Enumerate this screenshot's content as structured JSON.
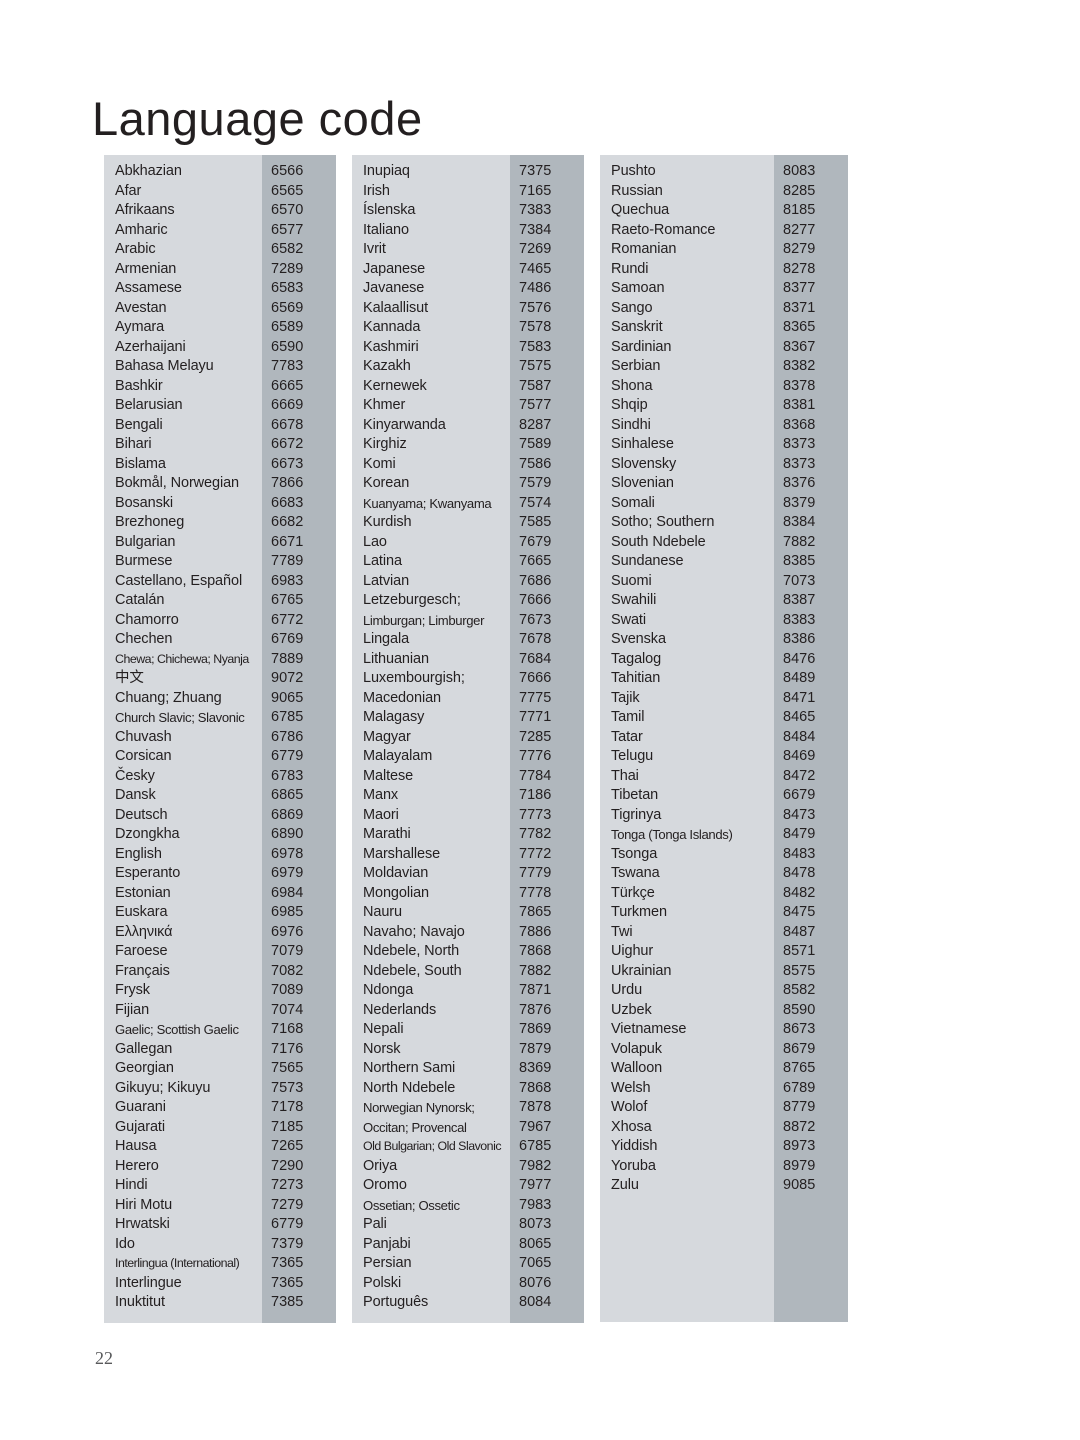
{
  "page": {
    "title": "Language code",
    "page_number": "22",
    "colors": {
      "name_cell_background": "#d6d9dd",
      "code_cell_background": "#b0b7bd",
      "text": "#231f20",
      "page_background": "#ffffff"
    }
  },
  "columns": [
    {
      "id": "column-1",
      "rows": [
        {
          "language": "Abkhazian",
          "code": "6566"
        },
        {
          "language": "Afar",
          "code": "6565"
        },
        {
          "language": "Afrikaans",
          "code": "6570"
        },
        {
          "language": "Amharic",
          "code": "6577"
        },
        {
          "language": "Arabic",
          "code": "6582"
        },
        {
          "language": "Armenian",
          "code": "7289"
        },
        {
          "language": "Assamese",
          "code": "6583"
        },
        {
          "language": "Avestan",
          "code": "6569"
        },
        {
          "language": "Aymara",
          "code": "6589"
        },
        {
          "language": "Azerhaijani",
          "code": "6590"
        },
        {
          "language": "Bahasa Melayu",
          "code": "7783"
        },
        {
          "language": "Bashkir",
          "code": "6665"
        },
        {
          "language": "Belarusian",
          "code": "6669"
        },
        {
          "language": "Bengali",
          "code": "6678"
        },
        {
          "language": "Bihari",
          "code": "6672"
        },
        {
          "language": "Bislama",
          "code": "6673"
        },
        {
          "language": "Bokmål, Norwegian",
          "code": "7866"
        },
        {
          "language": "Bosanski",
          "code": "6683"
        },
        {
          "language": "Brezhoneg",
          "code": "6682"
        },
        {
          "language": "Bulgarian",
          "code": "6671"
        },
        {
          "language": "Burmese",
          "code": "7789"
        },
        {
          "language": "Castellano, Español",
          "code": "6983"
        },
        {
          "language": "Catalán",
          "code": "6765"
        },
        {
          "language": "Chamorro",
          "code": "6772"
        },
        {
          "language": "Chechen",
          "code": "6769"
        },
        {
          "language": "Chewa; Chichewa; Nyanja",
          "code": "7889",
          "size": "tighter"
        },
        {
          "language": "中文",
          "code": "9072"
        },
        {
          "language": "Chuang; Zhuang",
          "code": "9065"
        },
        {
          "language": "Church Slavic; Slavonic",
          "code": "6785",
          "size": "tight"
        },
        {
          "language": "Chuvash",
          "code": "6786"
        },
        {
          "language": "Corsican",
          "code": "6779"
        },
        {
          "language": "Česky",
          "code": "6783"
        },
        {
          "language": "Dansk",
          "code": "6865"
        },
        {
          "language": "Deutsch",
          "code": "6869"
        },
        {
          "language": "Dzongkha",
          "code": "6890"
        },
        {
          "language": "English",
          "code": "6978"
        },
        {
          "language": "Esperanto",
          "code": "6979"
        },
        {
          "language": "Estonian",
          "code": "6984"
        },
        {
          "language": "Euskara",
          "code": "6985"
        },
        {
          "language": "Ελληνικά",
          "code": "6976"
        },
        {
          "language": "Faroese",
          "code": "7079"
        },
        {
          "language": "Français",
          "code": "7082"
        },
        {
          "language": "Frysk",
          "code": "7089"
        },
        {
          "language": "Fijian",
          "code": "7074"
        },
        {
          "language": "Gaelic; Scottish Gaelic",
          "code": "7168",
          "size": "tight"
        },
        {
          "language": "Gallegan",
          "code": "7176"
        },
        {
          "language": "Georgian",
          "code": "7565"
        },
        {
          "language": "Gikuyu; Kikuyu",
          "code": "7573"
        },
        {
          "language": "Guarani",
          "code": "7178"
        },
        {
          "language": "Gujarati",
          "code": "7185"
        },
        {
          "language": "Hausa",
          "code": "7265"
        },
        {
          "language": "Herero",
          "code": "7290"
        },
        {
          "language": "Hindi",
          "code": "7273"
        },
        {
          "language": "Hiri Motu",
          "code": "7279"
        },
        {
          "language": "Hrwatski",
          "code": "6779"
        },
        {
          "language": "Ido",
          "code": "7379"
        },
        {
          "language": "Interlingua (International)",
          "code": "7365",
          "size": "tighter"
        },
        {
          "language": "Interlingue",
          "code": "7365"
        },
        {
          "language": "Inuktitut",
          "code": "7385"
        }
      ]
    },
    {
      "id": "column-2",
      "rows": [
        {
          "language": "Inupiaq",
          "code": "7375"
        },
        {
          "language": "Irish",
          "code": "7165"
        },
        {
          "language": "Íslenska",
          "code": "7383"
        },
        {
          "language": "Italiano",
          "code": "7384"
        },
        {
          "language": "Ivrit",
          "code": "7269"
        },
        {
          "language": "Japanese",
          "code": "7465"
        },
        {
          "language": "Javanese",
          "code": "7486"
        },
        {
          "language": "Kalaallisut",
          "code": "7576"
        },
        {
          "language": "Kannada",
          "code": "7578"
        },
        {
          "language": "Kashmiri",
          "code": "7583"
        },
        {
          "language": "Kazakh",
          "code": "7575"
        },
        {
          "language": "Kernewek",
          "code": "7587"
        },
        {
          "language": "Khmer",
          "code": "7577"
        },
        {
          "language": "Kinyarwanda",
          "code": "8287"
        },
        {
          "language": "Kirghiz",
          "code": "7589"
        },
        {
          "language": "Komi",
          "code": "7586"
        },
        {
          "language": "Korean",
          "code": "7579"
        },
        {
          "language": "Kuanyama; Kwanyama",
          "code": "7574",
          "size": "tight"
        },
        {
          "language": "Kurdish",
          "code": "7585"
        },
        {
          "language": "Lao",
          "code": "7679"
        },
        {
          "language": "Latina",
          "code": "7665"
        },
        {
          "language": "Latvian",
          "code": "7686"
        },
        {
          "language": "Letzeburgesch;",
          "code": "7666"
        },
        {
          "language": "Limburgan; Limburger",
          "code": "7673",
          "size": "tight"
        },
        {
          "language": "Lingala",
          "code": "7678"
        },
        {
          "language": "Lithuanian",
          "code": "7684"
        },
        {
          "language": "Luxembourgish;",
          "code": "7666"
        },
        {
          "language": "Macedonian",
          "code": "7775"
        },
        {
          "language": "Malagasy",
          "code": "7771"
        },
        {
          "language": "Magyar",
          "code": "7285"
        },
        {
          "language": "Malayalam",
          "code": "7776"
        },
        {
          "language": "Maltese",
          "code": "7784"
        },
        {
          "language": "Manx",
          "code": "7186"
        },
        {
          "language": "Maori",
          "code": "7773"
        },
        {
          "language": "Marathi",
          "code": "7782"
        },
        {
          "language": "Marshallese",
          "code": "7772"
        },
        {
          "language": "Moldavian",
          "code": "7779"
        },
        {
          "language": "Mongolian",
          "code": "7778"
        },
        {
          "language": "Nauru",
          "code": "7865"
        },
        {
          "language": "Navaho; Navajo",
          "code": "7886"
        },
        {
          "language": "Ndebele, North",
          "code": "7868"
        },
        {
          "language": "Ndebele, South",
          "code": "7882"
        },
        {
          "language": "Ndonga",
          "code": "7871"
        },
        {
          "language": "Nederlands",
          "code": "7876"
        },
        {
          "language": "Nepali",
          "code": "7869"
        },
        {
          "language": "Norsk",
          "code": "7879"
        },
        {
          "language": "Northern Sami",
          "code": "8369"
        },
        {
          "language": "North Ndebele",
          "code": "7868"
        },
        {
          "language": "Norwegian Nynorsk;",
          "code": "7878",
          "size": "tight"
        },
        {
          "language": "Occitan; Provencal",
          "code": "7967",
          "size": "tight"
        },
        {
          "language": "Old Bulgarian; Old Slavonic",
          "code": "6785",
          "size": "tighter"
        },
        {
          "language": "Oriya",
          "code": "7982"
        },
        {
          "language": "Oromo",
          "code": "7977"
        },
        {
          "language": "Ossetian; Ossetic",
          "code": "7983",
          "size": "tight"
        },
        {
          "language": "Pali",
          "code": "8073"
        },
        {
          "language": "Panjabi",
          "code": "8065"
        },
        {
          "language": "Persian",
          "code": "7065"
        },
        {
          "language": "Polski",
          "code": "8076"
        },
        {
          "language": "Português",
          "code": "8084"
        }
      ]
    },
    {
      "id": "column-3",
      "rows": [
        {
          "language": "Pushto",
          "code": "8083"
        },
        {
          "language": "Russian",
          "code": "8285"
        },
        {
          "language": "Quechua",
          "code": "8185"
        },
        {
          "language": "Raeto-Romance",
          "code": "8277"
        },
        {
          "language": "Romanian",
          "code": "8279"
        },
        {
          "language": "Rundi",
          "code": "8278"
        },
        {
          "language": "Samoan",
          "code": "8377"
        },
        {
          "language": "Sango",
          "code": "8371"
        },
        {
          "language": "Sanskrit",
          "code": "8365"
        },
        {
          "language": "Sardinian",
          "code": "8367"
        },
        {
          "language": "Serbian",
          "code": "8382"
        },
        {
          "language": "Shona",
          "code": "8378"
        },
        {
          "language": "Shqip",
          "code": "8381"
        },
        {
          "language": "Sindhi",
          "code": "8368"
        },
        {
          "language": "Sinhalese",
          "code": "8373"
        },
        {
          "language": "Slovensky",
          "code": "8373"
        },
        {
          "language": "Slovenian",
          "code": "8376"
        },
        {
          "language": "Somali",
          "code": "8379"
        },
        {
          "language": "Sotho; Southern",
          "code": "8384"
        },
        {
          "language": "South Ndebele",
          "code": "7882"
        },
        {
          "language": "Sundanese",
          "code": "8385"
        },
        {
          "language": "Suomi",
          "code": "7073"
        },
        {
          "language": "Swahili",
          "code": "8387"
        },
        {
          "language": "Swati",
          "code": "8383"
        },
        {
          "language": "Svenska",
          "code": "8386"
        },
        {
          "language": "Tagalog",
          "code": "8476"
        },
        {
          "language": "Tahitian",
          "code": "8489"
        },
        {
          "language": "Tajik",
          "code": "8471"
        },
        {
          "language": "Tamil",
          "code": "8465"
        },
        {
          "language": "Tatar",
          "code": "8484"
        },
        {
          "language": "Telugu",
          "code": "8469"
        },
        {
          "language": "Thai",
          "code": "8472"
        },
        {
          "language": "Tibetan",
          "code": "6679"
        },
        {
          "language": "Tigrinya",
          "code": "8473"
        },
        {
          "language": "Tonga (Tonga Islands)",
          "code": "8479",
          "size": "tight"
        },
        {
          "language": "Tsonga",
          "code": "8483"
        },
        {
          "language": "Tswana",
          "code": "8478"
        },
        {
          "language": "Türkçe",
          "code": "8482"
        },
        {
          "language": "Turkmen",
          "code": "8475"
        },
        {
          "language": "Twi",
          "code": "8487"
        },
        {
          "language": "Uighur",
          "code": "8571"
        },
        {
          "language": "Ukrainian",
          "code": "8575"
        },
        {
          "language": "Urdu",
          "code": "8582"
        },
        {
          "language": "Uzbek",
          "code": "8590"
        },
        {
          "language": "Vietnamese",
          "code": "8673"
        },
        {
          "language": "Volapuk",
          "code": "8679"
        },
        {
          "language": "Walloon",
          "code": "8765"
        },
        {
          "language": "Welsh",
          "code": "6789"
        },
        {
          "language": "Wolof",
          "code": "8779"
        },
        {
          "language": "Xhosa",
          "code": "8872"
        },
        {
          "language": "Yiddish",
          "code": "8973"
        },
        {
          "language": "Yoruba",
          "code": "8979"
        },
        {
          "language": "Zulu",
          "code": "9085"
        }
      ]
    }
  ]
}
